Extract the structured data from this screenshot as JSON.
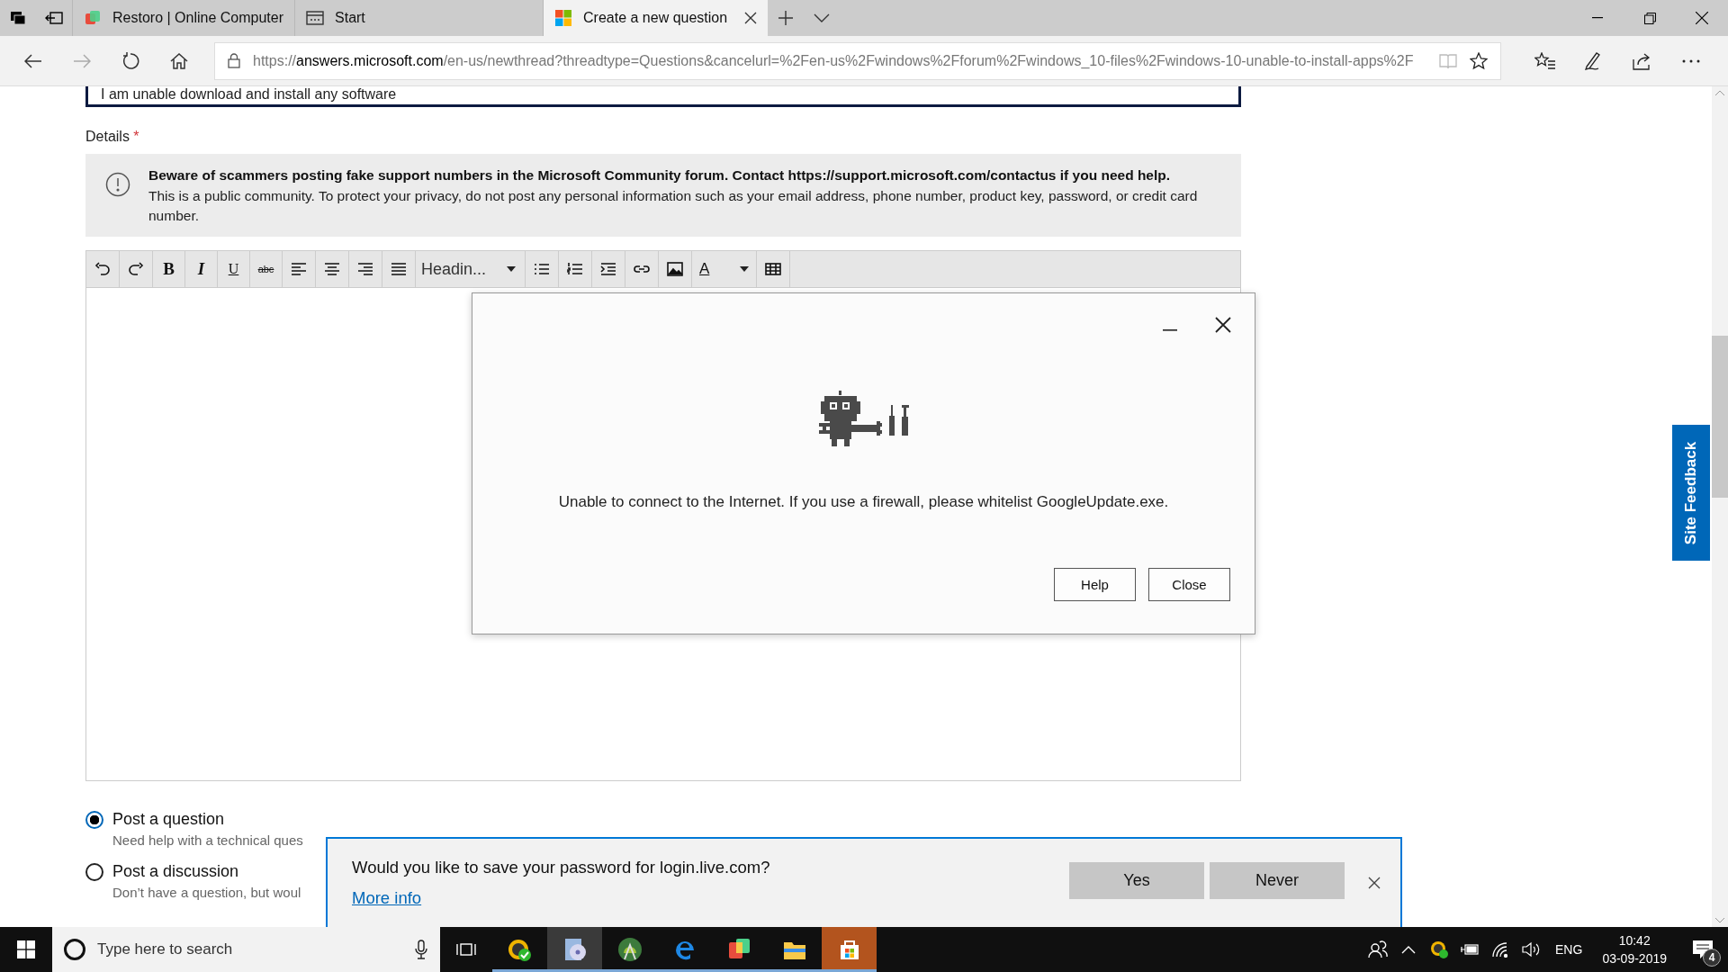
{
  "browser": {
    "tabs": [
      {
        "title": "Restoro | Online Computer",
        "kind": "restoro",
        "selected": false
      },
      {
        "title": "Start",
        "kind": "start",
        "selected": false
      },
      {
        "title": "Create a new question",
        "kind": "windows",
        "selected": true
      }
    ],
    "url_scheme": "https://",
    "url_host": "answers.microsoft.com",
    "url_path": "/en-us/newthread?threadtype=Questions&cancelurl=%2Fen-us%2Fwindows%2Fforum%2Fwindows_10-files%2Fwindows-10-unable-to-install-apps%2F"
  },
  "page": {
    "title_field": {
      "value": "I am unable download and install any software"
    },
    "details_label": "Details",
    "required_mark": "*",
    "notice": {
      "headline": "Beware of scammers posting fake support numbers in the Microsoft Community forum. Contact https://support.microsoft.com/contactus if you need help.",
      "text": "This is a public community. To protect your privacy, do not post any personal information such as your email address, phone number, product key, password, or credit card number."
    },
    "toolbar": [
      {
        "kind": "undo"
      },
      {
        "kind": "redo"
      },
      {
        "kind": "bold",
        "label": "B"
      },
      {
        "kind": "italic",
        "label": "I"
      },
      {
        "kind": "underline",
        "label": "U"
      },
      {
        "kind": "strike",
        "label": "abc"
      },
      {
        "kind": "align-left"
      },
      {
        "kind": "align-center"
      },
      {
        "kind": "align-right"
      },
      {
        "kind": "justify"
      },
      {
        "kind": "dropdown",
        "label": "Headin..."
      },
      {
        "kind": "bullets"
      },
      {
        "kind": "numbers"
      },
      {
        "kind": "indent"
      },
      {
        "kind": "link"
      },
      {
        "kind": "image"
      },
      {
        "kind": "font-color",
        "label": "A"
      },
      {
        "kind": "table"
      }
    ],
    "post_types": [
      {
        "label": "Post a question",
        "description": "Need help with a technical ques",
        "selected": true
      },
      {
        "label": "Post a discussion",
        "description": "Don’t have a question, but woul",
        "selected": false
      }
    ],
    "site_feedback": "Site Feedback"
  },
  "dialog": {
    "message": "Unable to connect to the Internet. If you use a firewall, please whitelist GoogleUpdate.exe.",
    "buttons": [
      "Help",
      "Close"
    ]
  },
  "password_bar": {
    "message": "Would you like to save your password for login.live.com?",
    "link": "More info",
    "buttons": [
      "Yes",
      "Never"
    ]
  },
  "taskbar": {
    "search_placeholder": "Type here to search",
    "apps": [
      {
        "kind": "check",
        "selected": false
      },
      {
        "kind": "disc",
        "selected": true
      },
      {
        "kind": "android",
        "selected": false
      },
      {
        "kind": "edge",
        "selected": false
      },
      {
        "kind": "cube",
        "selected": false
      },
      {
        "kind": "folder",
        "selected": false
      },
      {
        "kind": "store",
        "selected": false
      }
    ],
    "language": "ENG",
    "time": "10:42",
    "date": "03-09-2019",
    "notification_count": "4"
  }
}
